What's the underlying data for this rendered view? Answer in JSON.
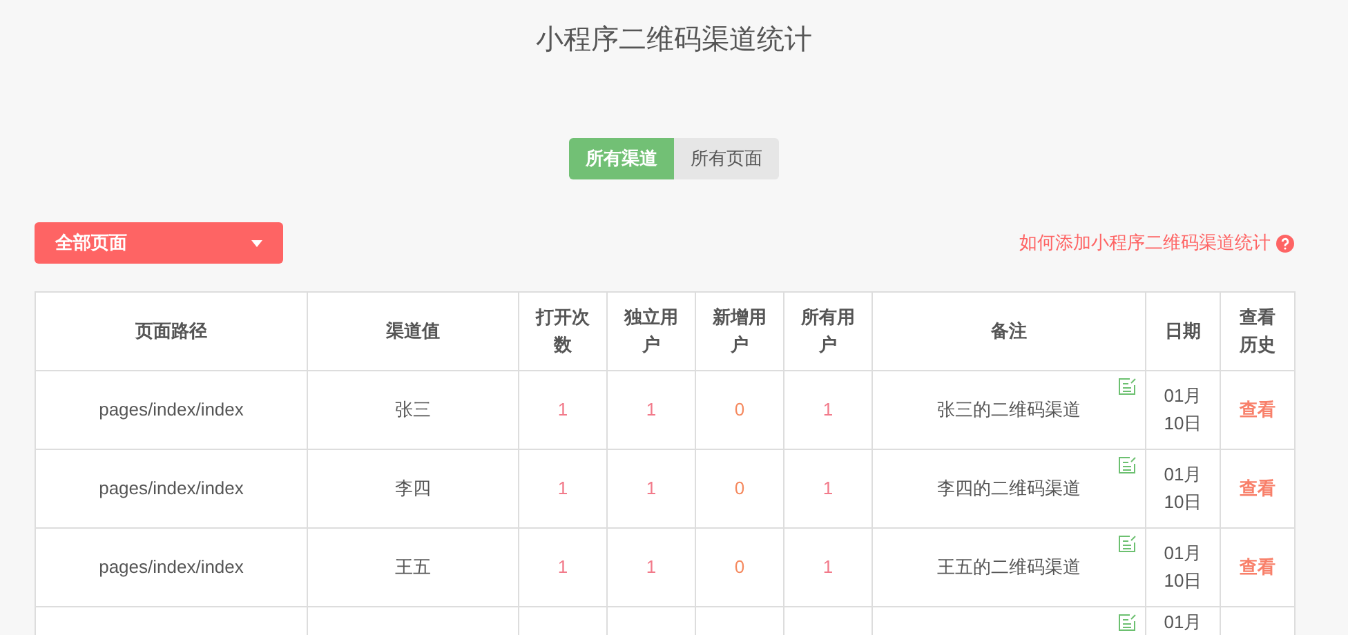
{
  "title": "小程序二维码渠道统计",
  "tabs": [
    {
      "label": "所有渠道",
      "selected": true
    },
    {
      "label": "所有页面",
      "selected": false
    }
  ],
  "page_select": {
    "value": "全部页面"
  },
  "help_link": "如何添加小程序二维码渠道统计",
  "table": {
    "columns": [
      "页面路径",
      "渠道值",
      "打开次数",
      "独立用户",
      "新增用户",
      "所有用户",
      "备注",
      "日期",
      "查看历史"
    ],
    "rows": [
      {
        "path": "pages/index/index",
        "channel": "张三",
        "opens": "1",
        "unique_users": "1",
        "new_users": "0",
        "all_users": "1",
        "note": "张三的二维码渠道",
        "date": "01月10日",
        "action": "查看"
      },
      {
        "path": "pages/index/index",
        "channel": "李四",
        "opens": "1",
        "unique_users": "1",
        "new_users": "0",
        "all_users": "1",
        "note": "李四的二维码渠道",
        "date": "01月10日",
        "action": "查看"
      },
      {
        "path": "pages/index/index",
        "channel": "王五",
        "opens": "1",
        "unique_users": "1",
        "new_users": "0",
        "all_users": "1",
        "note": "王五的二维码渠道",
        "date": "01月10日",
        "action": "查看"
      },
      {
        "date": "01月"
      }
    ]
  }
}
